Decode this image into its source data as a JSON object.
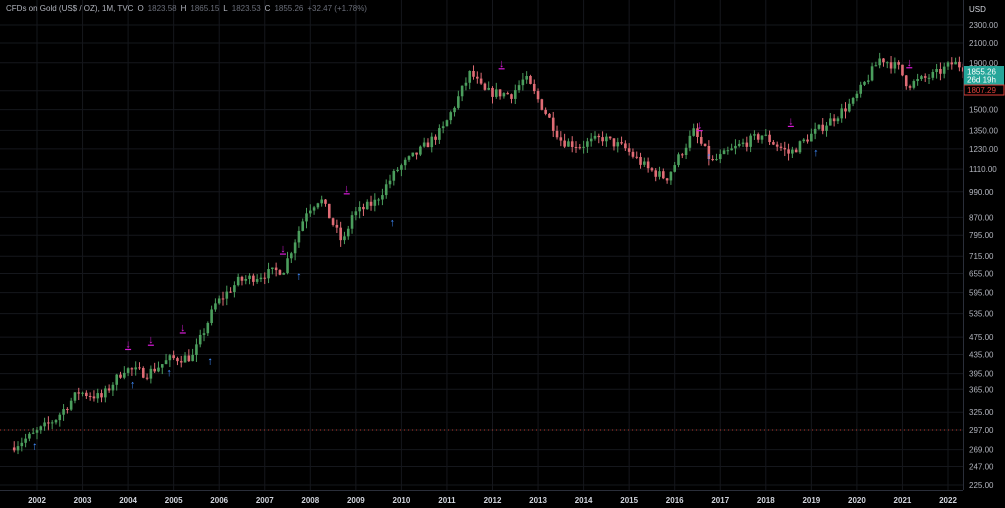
{
  "legend": {
    "symbol": "CFDs on Gold (US$ / OZ), 1M, TVC",
    "open_label": "O",
    "open_value": "1823.58",
    "high_label": "H",
    "high_value": "1865.15",
    "low_label": "L",
    "low_value": "1823.53",
    "close_label": "C",
    "close_value": "1855.26",
    "change": "+32.47 (+1.78%)"
  },
  "axis": {
    "unit": "USD",
    "price_ticks": [
      "2300.00",
      "2100.00",
      "1900.00",
      "1650.00",
      "1500.00",
      "1350.00",
      "1230.00",
      "1110.00",
      "990.00",
      "870.00",
      "795.00",
      "715.00",
      "655.00",
      "595.00",
      "535.00",
      "475.00",
      "435.00",
      "395.00",
      "365.00",
      "325.00",
      "297.00",
      "269.00",
      "247.00",
      "225.00"
    ],
    "year_ticks": [
      "2002",
      "2003",
      "2004",
      "2005",
      "2006",
      "2007",
      "2008",
      "2009",
      "2010",
      "2011",
      "2012",
      "2013",
      "2014",
      "2015",
      "2016",
      "2017",
      "2018",
      "2019",
      "2020",
      "2021",
      "2022"
    ]
  },
  "badges": {
    "price": "1855.26",
    "countdown": "26d 19h",
    "ref_price": "1807.29"
  },
  "colors": {
    "up": "#4b9e5d",
    "down": "#e06c75",
    "buy_arrow": "#3f8cff",
    "sell_arrow": "#d81bd8",
    "price_badge": "#26a69a",
    "ref_badge": "#e0403a",
    "grid": "#15171c"
  },
  "chart_data": {
    "type": "candlestick",
    "title": "CFDs on Gold (US$ / OZ), 1M, TVC",
    "ylabel": "USD",
    "y_scale": "log",
    "ylim": [
      225,
      2300
    ],
    "x_range": [
      2001.5,
      2022.45
    ],
    "anchors": [
      [
        2001.5,
        272
      ],
      [
        2002.0,
        290
      ],
      [
        2002.5,
        315
      ],
      [
        2003.0,
        360
      ],
      [
        2003.5,
        350
      ],
      [
        2004.0,
        405
      ],
      [
        2004.5,
        395
      ],
      [
        2005.0,
        425
      ],
      [
        2005.5,
        430
      ],
      [
        2006.0,
        560
      ],
      [
        2006.5,
        630
      ],
      [
        2007.0,
        650
      ],
      [
        2007.5,
        670
      ],
      [
        2008.0,
        900
      ],
      [
        2008.3,
        960
      ],
      [
        2008.8,
        760
      ],
      [
        2009.0,
        880
      ],
      [
        2009.5,
        940
      ],
      [
        2010.0,
        1110
      ],
      [
        2010.5,
        1220
      ],
      [
        2011.0,
        1360
      ],
      [
        2011.6,
        1810
      ],
      [
        2011.9,
        1640
      ],
      [
        2012.5,
        1620
      ],
      [
        2012.8,
        1760
      ],
      [
        2013.3,
        1450
      ],
      [
        2013.6,
        1280
      ],
      [
        2014.0,
        1250
      ],
      [
        2014.5,
        1300
      ],
      [
        2015.0,
        1230
      ],
      [
        2015.5,
        1110
      ],
      [
        2015.9,
        1060
      ],
      [
        2016.5,
        1340
      ],
      [
        2016.9,
        1150
      ],
      [
        2017.5,
        1250
      ],
      [
        2018.0,
        1320
      ],
      [
        2018.6,
        1200
      ],
      [
        2019.0,
        1300
      ],
      [
        2019.5,
        1420
      ],
      [
        2020.0,
        1560
      ],
      [
        2020.6,
        1950
      ],
      [
        2021.0,
        1850
      ],
      [
        2021.2,
        1700
      ],
      [
        2021.8,
        1790
      ],
      [
        2022.2,
        1900
      ],
      [
        2022.45,
        1855
      ]
    ],
    "buy_markers": [
      [
        2001.95,
        275
      ],
      [
        2004.1,
        375
      ],
      [
        2004.9,
        398
      ],
      [
        2005.8,
        422
      ],
      [
        2007.75,
        648
      ],
      [
        2009.8,
        850
      ],
      [
        2016.75,
        1185
      ],
      [
        2019.1,
        1212
      ]
    ],
    "sell_markers": [
      [
        2004.0,
        460
      ],
      [
        2004.5,
        470
      ],
      [
        2005.2,
        500
      ],
      [
        2007.4,
        745
      ],
      [
        2008.8,
        1010
      ],
      [
        2012.2,
        1900
      ],
      [
        2016.55,
        1390
      ],
      [
        2018.55,
        1420
      ],
      [
        2021.15,
        1910
      ]
    ],
    "reference_line": 297
  }
}
